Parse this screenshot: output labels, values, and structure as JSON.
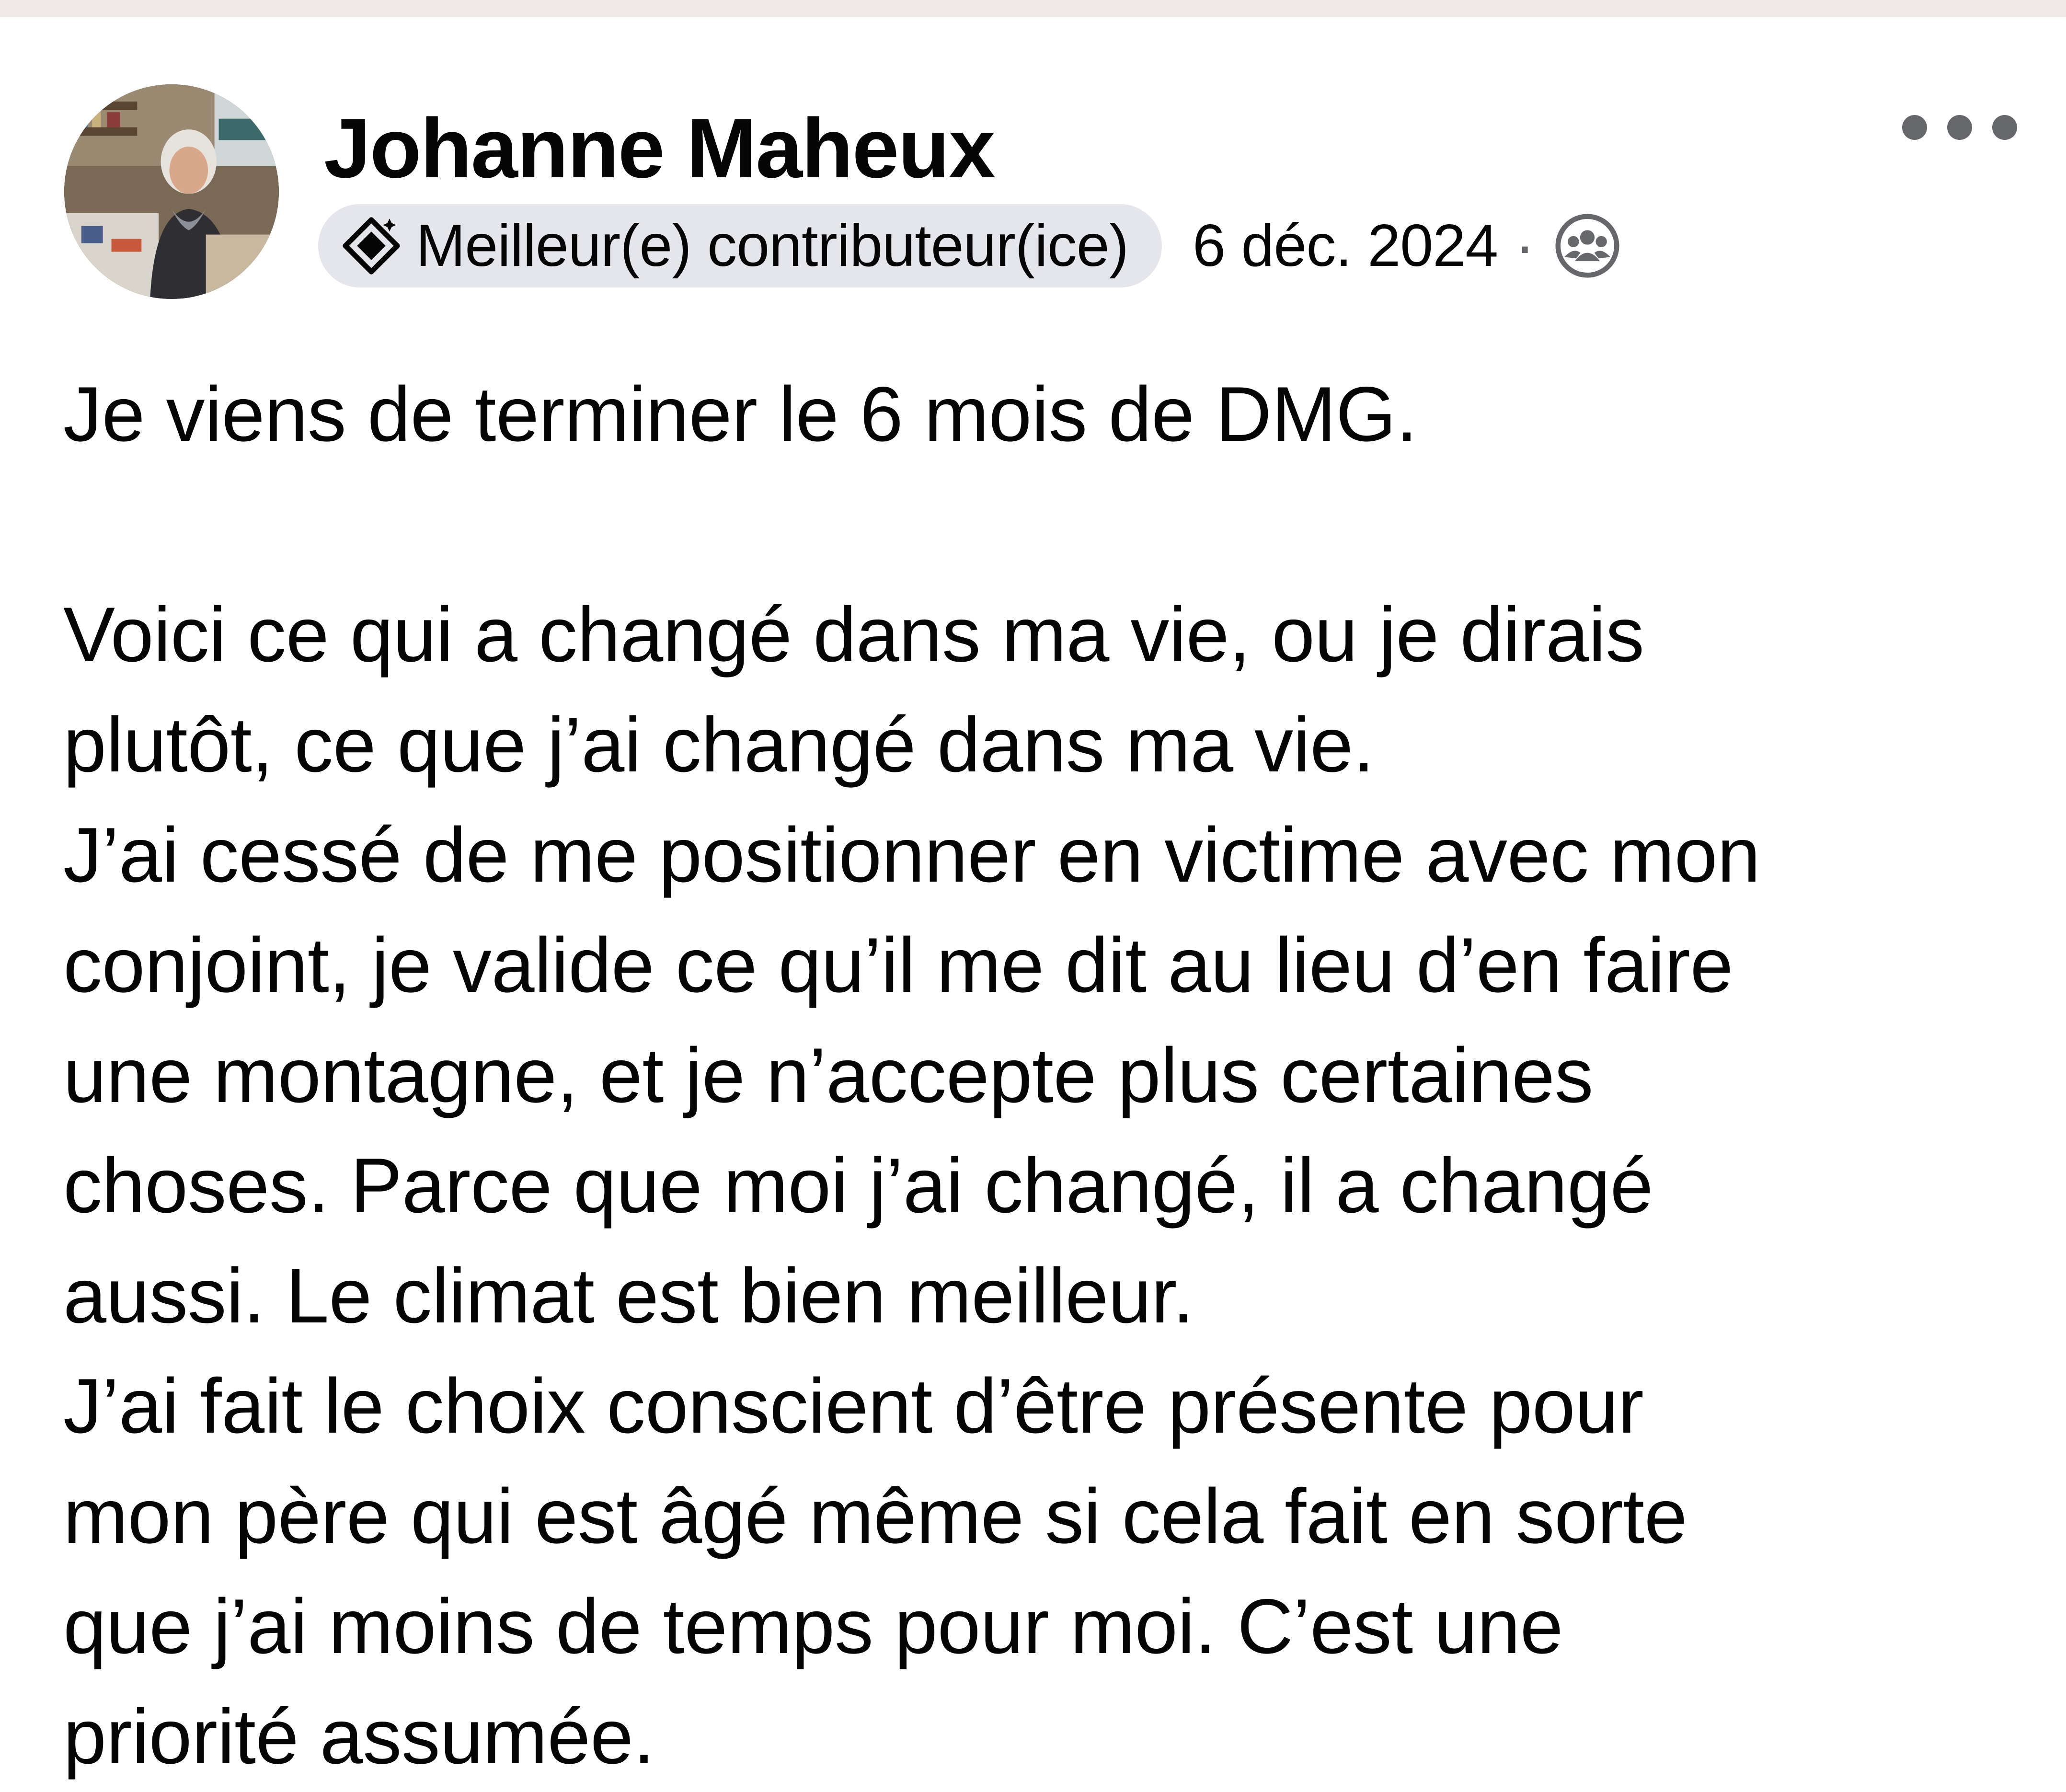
{
  "post": {
    "author": {
      "name": "Johanne Maheux",
      "avatar_icon": "profile-photo"
    },
    "badge": {
      "label": "Meilleur(e) contributeur(ice)",
      "icon": "top-contributor-icon"
    },
    "date": "6 déc. 2024",
    "separator": "·",
    "audience_icon": "group-members-icon",
    "more_icon": "more-options-icon",
    "body_lines": [
      "Je viens de terminer le 6 mois de DMG.",
      "",
      "Voici ce qui a changé dans ma vie, ou je dirais",
      "plutôt, ce que j’ai changé dans ma vie.",
      "J’ai cessé de me positionner en victime avec mon",
      "conjoint, je valide ce qu’il me dit au lieu d’en faire",
      "une montagne,  et je n’accepte plus certaines",
      "choses.  Parce que moi j’ai changé, il a changé",
      "aussi.  Le climat est bien meilleur.",
      "J’ai fait le choix conscient d’être présente pour",
      "mon père qui est âgé même si cela fait en sorte",
      "que j’ai moins de temps pour moi. C’est une",
      "priorité assumée."
    ]
  }
}
